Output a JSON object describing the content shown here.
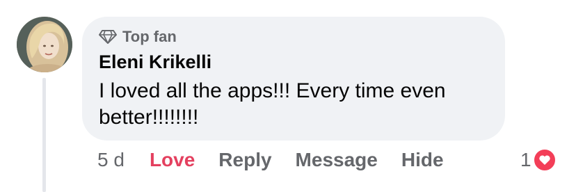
{
  "comment": {
    "badge_label": "Top fan",
    "badge_icon": "diamond-icon",
    "author": "Eleni Krikelli",
    "text": "I loved all the apps!!! Every time even better!!!!!!!!"
  },
  "actions": {
    "timestamp": "5 d",
    "love_label": "Love",
    "reply_label": "Reply",
    "message_label": "Message",
    "hide_label": "Hide"
  },
  "reactions": {
    "count": "1",
    "icon": "heart-icon",
    "color": "#f33e58"
  },
  "colors": {
    "bubble": "#f0f2f5",
    "secondary_text": "#65676b",
    "love_active": "#e4405f",
    "primary_text": "#050505"
  }
}
